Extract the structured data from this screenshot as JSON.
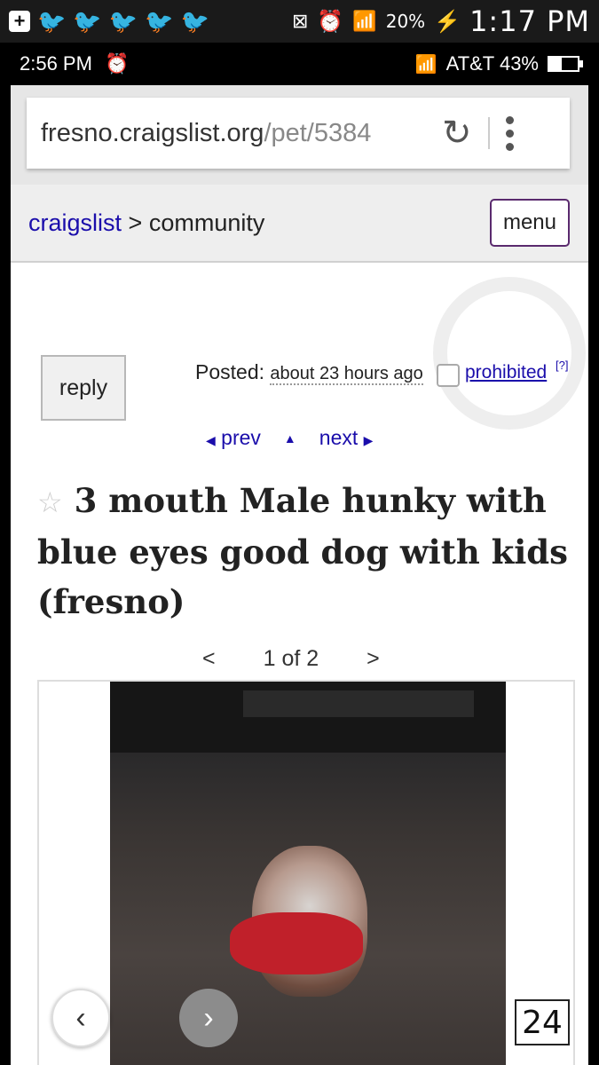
{
  "outer_status": {
    "battery_percent": "20%",
    "time": "1:17 PM"
  },
  "inner_status": {
    "time": "2:56 PM",
    "carrier_battery": "AT&T 43%",
    "battery_level": 0.43
  },
  "browser": {
    "url_domain": "fresno.craigslist.org",
    "url_path": "/pet/5384"
  },
  "header": {
    "site": "craigslist",
    "separator": ">",
    "section": "community",
    "menu_label": "menu"
  },
  "post": {
    "reply_label": "reply",
    "posted_label": "Posted:",
    "posted_time": "about 23 hours ago",
    "prohibited_label": "prohibited",
    "help_label": "[?]",
    "prev_label": "prev",
    "next_label": "next",
    "title": "3 mouth Male hunky with blue eyes good dog with kids",
    "location": "(fresno)"
  },
  "gallery": {
    "prev_symbol": "<",
    "page_text": "1 of 2",
    "next_symbol": ">",
    "counter": "24"
  }
}
